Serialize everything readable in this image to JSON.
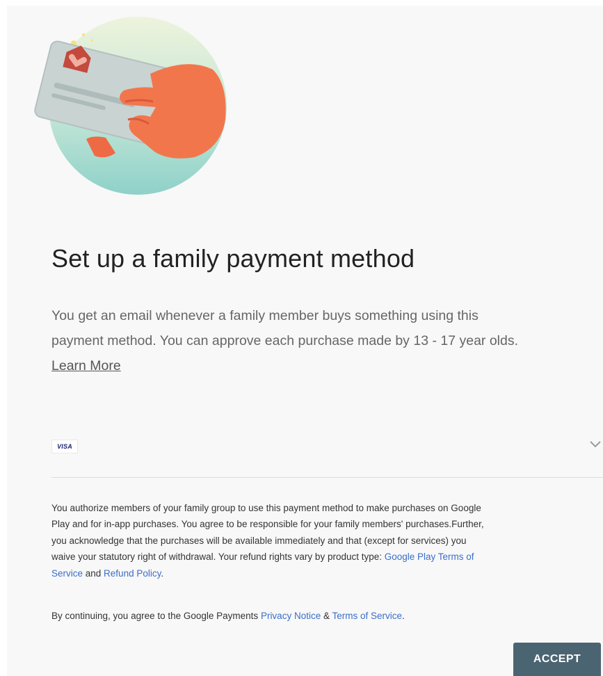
{
  "header": {
    "title": "Set up a family payment method"
  },
  "description": {
    "line1": "You get an email whenever a family member buys something using this",
    "line2": "payment method. You can approve each purchase made by 13 - 17 year olds.",
    "learn_more": "Learn More"
  },
  "payment": {
    "card_brand": "VISA",
    "expand_icon": "chevron-down-icon"
  },
  "terms": {
    "line1": "You authorize members of your family group to use this payment method to make purchases on Google",
    "line2": "Play and for in-app purchases. You agree to be responsible for your family members' purchases.Further,",
    "line3": "you acknowledge that the purchases will be available immediately and that (except for services) you",
    "line4_text": "waive your statutory right of withdrawal. Your refund rights vary by product type: ",
    "line4_link": "Google Play Terms of",
    "line5_link": "Service",
    "line5_and": " and ",
    "line5_link2": "Refund Policy",
    "line5_end": "."
  },
  "continue": {
    "text": "By continuing, you agree to the Google Payments ",
    "privacy_link": "Privacy Notice",
    "amp": " & ",
    "tos_link": "Terms of Service",
    "end": "."
  },
  "actions": {
    "accept_label": "ACCEPT"
  },
  "colors": {
    "link": "#3b6ec9",
    "accept_button": "#4b6471",
    "illustration_hand": "#f2764c",
    "illustration_bg": "#a8ddd0"
  },
  "icons": {
    "illustration": "hand-holding-card-illustration"
  }
}
